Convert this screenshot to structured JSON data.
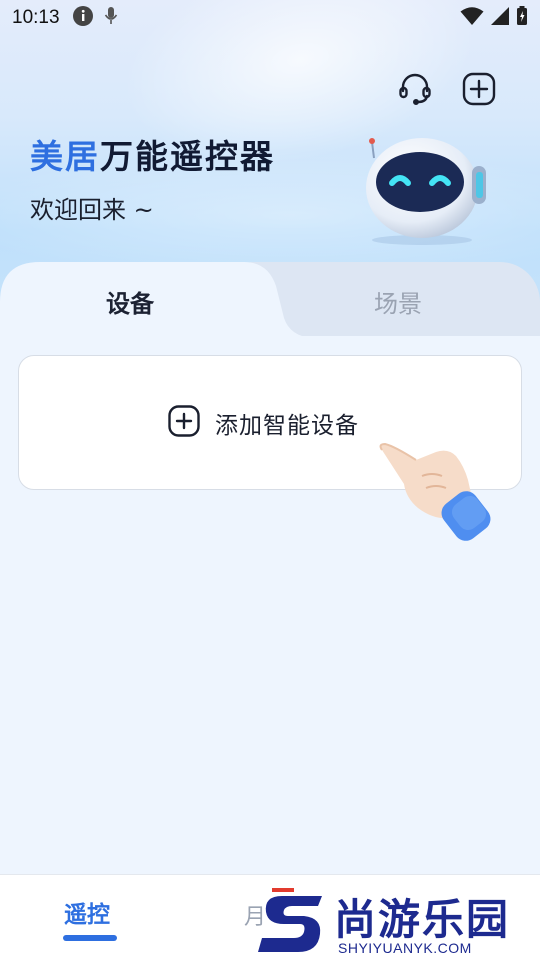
{
  "status_bar": {
    "time": "10:13",
    "icons": [
      "info-icon",
      "mic-icon",
      "wifi-icon",
      "signal-icon",
      "battery-icon"
    ]
  },
  "header": {
    "title_accent": "美居",
    "title_rest": "万能遥控器",
    "subtitle": "欢迎回来 ~",
    "actions": [
      "headset-icon",
      "add-icon"
    ]
  },
  "tabs": [
    {
      "label": "设备",
      "active": true
    },
    {
      "label": "场景",
      "active": false
    }
  ],
  "main": {
    "add_device_label": "添加智能设备"
  },
  "bottom_nav": {
    "items": [
      {
        "label": "遥控",
        "active": true
      },
      {
        "label": "月",
        "active": false
      }
    ]
  },
  "watermark": {
    "text": "尚游乐园",
    "url": "SHYIYUANYK.COM"
  },
  "colors": {
    "accent": "#2e6fe0",
    "text_dark": "#111a33",
    "inactive": "#9aa3b2"
  }
}
